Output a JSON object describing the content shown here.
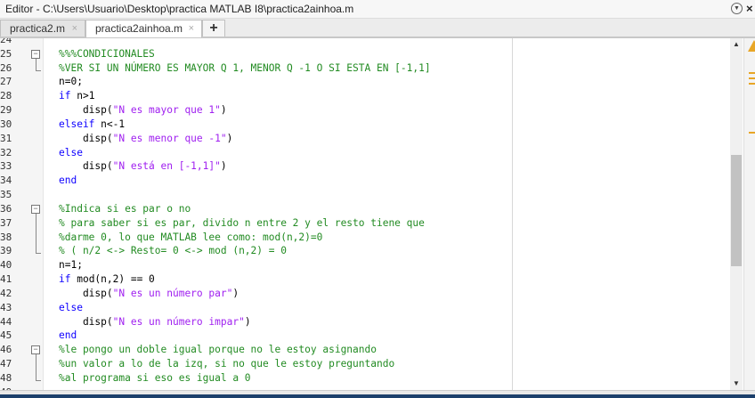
{
  "window": {
    "title": "Editor - C:\\Users\\Usuario\\Desktop\\practica MATLAB I8\\practica2ainhoa.m"
  },
  "tabs": [
    {
      "label": "practica2.m",
      "active": false
    },
    {
      "label": "practica2ainhoa.m",
      "active": true
    }
  ],
  "icons": {
    "close": "×",
    "new_tab": "+",
    "dropdown": "▼",
    "scroll_up": "▲",
    "scroll_down": "▼"
  },
  "colors": {
    "keyword": "#0e00ff",
    "comment": "#228b22",
    "string": "#a020f0",
    "warning": "#e8a626"
  },
  "first_line": 24,
  "lines": [
    [],
    [
      [
        "c",
        "%%%CONDICIONALES"
      ]
    ],
    [
      [
        "c",
        "%VER SI UN NÚMERO ES MAYOR Q 1, MENOR Q -1 O SI ESTA EN [-1,1]"
      ]
    ],
    [
      [
        "n",
        "n=0;"
      ]
    ],
    [
      [
        "k",
        "if"
      ],
      [
        "n",
        " n>1"
      ]
    ],
    [
      [
        "n",
        "    disp("
      ],
      [
        "s",
        "\"N es mayor que 1\""
      ],
      [
        "n",
        ")"
      ]
    ],
    [
      [
        "k",
        "elseif"
      ],
      [
        "n",
        " n<-1"
      ]
    ],
    [
      [
        "n",
        "    disp("
      ],
      [
        "s",
        "\"N es menor que -1\""
      ],
      [
        "n",
        ")"
      ]
    ],
    [
      [
        "k",
        "else"
      ]
    ],
    [
      [
        "n",
        "    disp("
      ],
      [
        "s",
        "\"N está en [-1,1]\""
      ],
      [
        "n",
        ")"
      ]
    ],
    [
      [
        "k",
        "end"
      ]
    ],
    [],
    [
      [
        "c",
        "%Indica si es par o no"
      ]
    ],
    [
      [
        "c",
        "% para saber si es par, divido n entre 2 y el resto tiene que"
      ]
    ],
    [
      [
        "c",
        "%darme 0, lo que MATLAB lee como: mod(n,2)=0"
      ]
    ],
    [
      [
        "c",
        "% ( n/2 <-> Resto= 0 <-> mod (n,2) = 0"
      ]
    ],
    [
      [
        "n",
        "n=1;"
      ]
    ],
    [
      [
        "k",
        "if"
      ],
      [
        "n",
        " mod(n,2) == 0"
      ]
    ],
    [
      [
        "n",
        "    disp("
      ],
      [
        "s",
        "\"N es un número par\""
      ],
      [
        "n",
        ")"
      ]
    ],
    [
      [
        "k",
        "else"
      ]
    ],
    [
      [
        "n",
        "    disp("
      ],
      [
        "s",
        "\"N es un número impar\""
      ],
      [
        "n",
        ")"
      ]
    ],
    [
      [
        "k",
        "end"
      ]
    ],
    [
      [
        "c",
        "%le pongo un doble igual porque no le estoy asignando"
      ]
    ],
    [
      [
        "c",
        "%un valor a lo de la izq, si no que le estoy preguntando"
      ]
    ],
    [
      [
        "c",
        "%al programa si eso es igual a 0"
      ]
    ],
    []
  ],
  "folds": [
    {
      "start": 25,
      "end": 26
    },
    {
      "start": 36,
      "end": 39
    },
    {
      "start": 46,
      "end": 48
    }
  ]
}
